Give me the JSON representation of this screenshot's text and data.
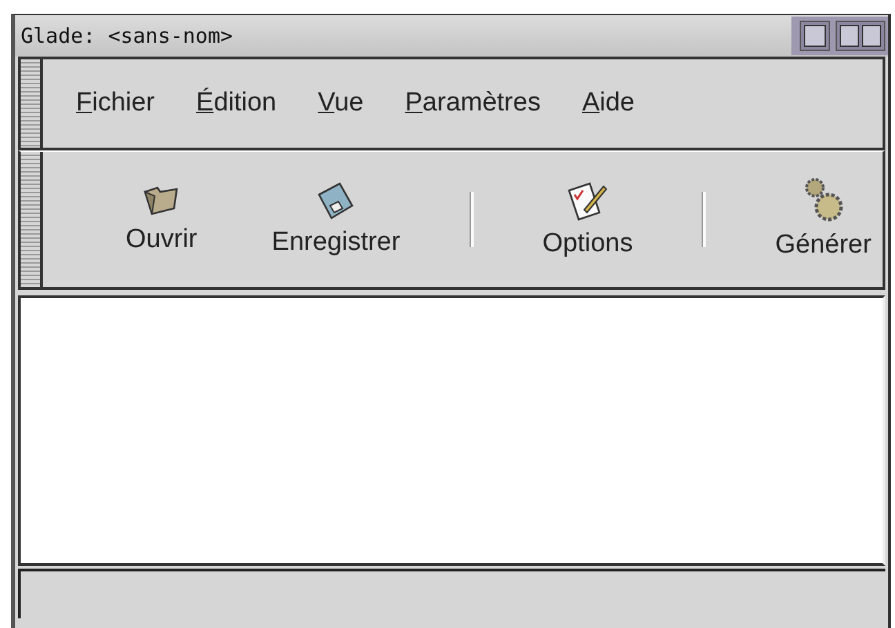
{
  "window": {
    "title": "Glade: <sans-nom>"
  },
  "menu": [
    {
      "key": "F",
      "rest": "ichier"
    },
    {
      "key": "É",
      "rest": "dition"
    },
    {
      "key": "V",
      "rest": "ue"
    },
    {
      "key": "P",
      "rest": "aramètres"
    },
    {
      "key": "A",
      "rest": "ide"
    }
  ],
  "toolbar": [
    {
      "kind": "button",
      "label": "Ouvrir"
    },
    {
      "kind": "button",
      "label": "Enregistrer"
    },
    {
      "kind": "separator"
    },
    {
      "kind": "button",
      "label": "Options"
    },
    {
      "kind": "separator"
    },
    {
      "kind": "button",
      "label": "Générer"
    }
  ]
}
